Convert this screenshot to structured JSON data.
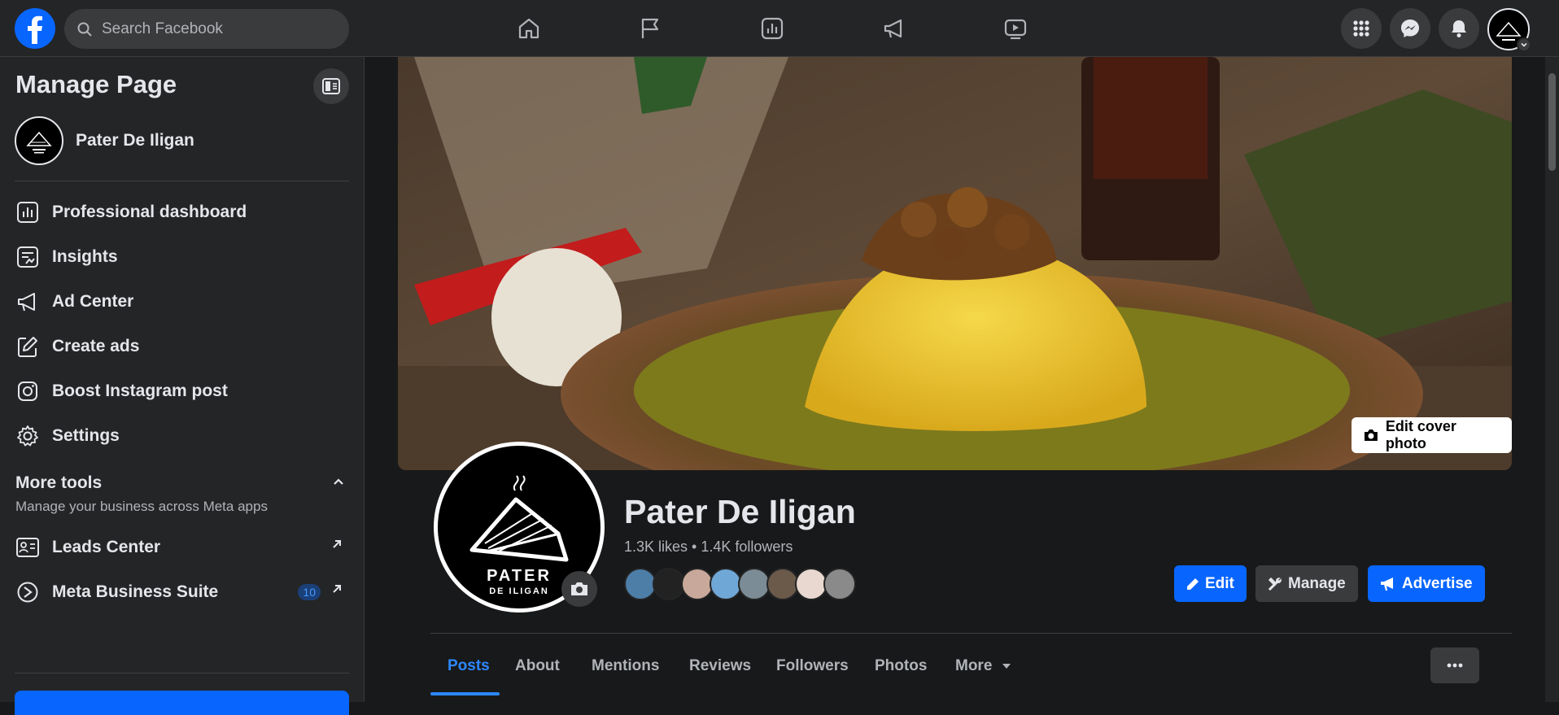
{
  "topbar": {
    "search_placeholder": "Search Facebook",
    "nav_icons": [
      "home-icon",
      "flag-icon",
      "insights-icon",
      "megaphone-icon",
      "video-icon"
    ],
    "right_icons": [
      "menu-grid-icon",
      "messenger-icon",
      "bell-icon"
    ]
  },
  "sidebar": {
    "title": "Manage Page",
    "page_name": "Pater De Iligan",
    "items": [
      {
        "label": "Professional dashboard",
        "icon": "dashboard-icon"
      },
      {
        "label": "Insights",
        "icon": "insights-icon"
      },
      {
        "label": "Ad Center",
        "icon": "megaphone-icon"
      },
      {
        "label": "Create ads",
        "icon": "pencil-icon"
      },
      {
        "label": "Boost Instagram post",
        "icon": "instagram-icon"
      },
      {
        "label": "Settings",
        "icon": "gear-icon"
      }
    ],
    "more_tools": {
      "heading": "More tools",
      "subtitle": "Manage your business across Meta apps",
      "items": [
        {
          "label": "Leads Center",
          "icon": "contact-card-icon"
        },
        {
          "label": "Meta Business Suite",
          "icon": "meta-business-icon",
          "badge": "10"
        }
      ]
    }
  },
  "main": {
    "edit_cover_label": "Edit cover photo",
    "page_name": "Pater De Iligan",
    "stats": "1.3K likes • 1.4K followers",
    "logo_text_1": "PATER",
    "logo_text_2": "DE ILIGAN",
    "buttons": {
      "edit": "Edit",
      "manage": "Manage",
      "advertise": "Advertise"
    },
    "tabs": [
      "Posts",
      "About",
      "Mentions",
      "Reviews",
      "Followers",
      "Photos",
      "More"
    ],
    "active_tab": "Posts"
  },
  "colors": {
    "brand_blue": "#0866ff",
    "active_tab": "#2d88ff",
    "surface": "#242526",
    "background": "#18191a"
  }
}
